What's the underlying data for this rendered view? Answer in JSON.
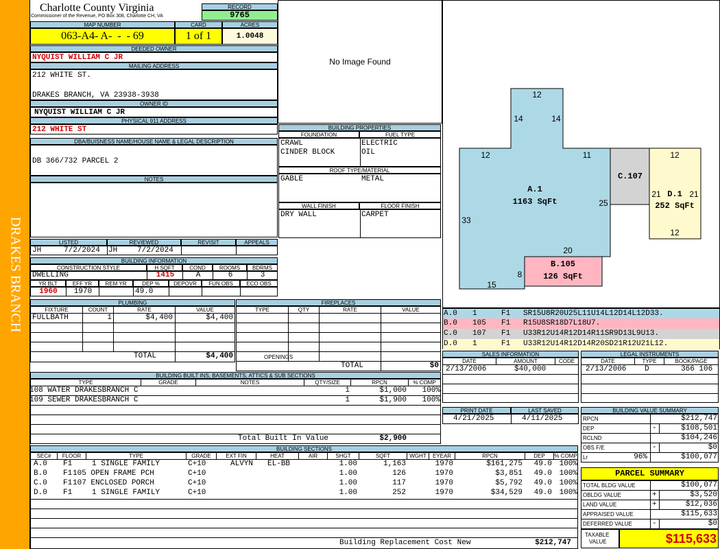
{
  "colors": {
    "sidebar": "#ffa500",
    "header_blue": "#a8cfe0",
    "map_yellow": "#ffff00",
    "record_green": "#90ee90",
    "accent_red": "#d00000",
    "seg_a": "#add8e6",
    "seg_b": "#ffb6c1",
    "seg_c": "#d3d3d3",
    "seg_d": "#fffacd"
  },
  "sidebar": {
    "district": "DRAKES BRANCH"
  },
  "header": {
    "county": "Charlotte County Virginia",
    "address": "Commissioner of the Revenue, PO Box 308, Charlotte CH, VA",
    "record_label": "RECORD",
    "record_value": "9765",
    "map_label": "MAP NUMBER",
    "map_value": "063-A4- A-  -  - 69",
    "card_label": "CARD",
    "card_value": "1 of 1",
    "acres_label": "ACRES",
    "acres_value": "1.0048"
  },
  "owner": {
    "deeded_label": "DEEDED OWNER",
    "deeded_value": "NYQUIST WILLIAM C JR",
    "mailing_label": "MAILING ADDRESS",
    "mailing_line1": "212 WHITE ST.",
    "mailing_line2": "DRAKES BRANCH, VA 23938-3938",
    "owner_id_label": "OWNER ID",
    "owner_id_value": "NYQUIST WILLIAM C JR",
    "physical_label": "PHYSICAL 911 ADDRESS",
    "physical_value": "212 WHITE ST",
    "dba_label": "DBA/BUISNESS NAME/HOUSE NAME & LEGAL DESCRIPTION",
    "dba_value": "DB 366/732 PARCEL 2",
    "notes_label": "NOTES"
  },
  "photo": {
    "text": "No Image Found"
  },
  "building_props": {
    "title": "BUILDING PROPERTIES",
    "foundation_label": "FOUNDATION",
    "foundation_values": [
      "CRAWL",
      "CINDER BLOCK"
    ],
    "fuel_label": "FUEL TYPE",
    "fuel_values": [
      "ELECTRIC",
      "OIL"
    ],
    "roof_label": "ROOF TYPE/MATERIAL",
    "roof_type": "GABLE",
    "roof_material": "METAL",
    "wall_label": "WALL FINISH",
    "wall_value": "DRY WALL",
    "floor_label": "FLOOR FINISH",
    "floor_value": "CARPET"
  },
  "review": {
    "listed_label": "LISTED",
    "reviewed_label": "REVIEWED",
    "revisit_label": "REVISIT",
    "appeals_label": "APPEALS",
    "listed_by": "JH",
    "listed_date": "7/2/2024",
    "reviewed_by": "JH",
    "reviewed_date": "7/2/2024"
  },
  "building_info": {
    "title": "BUILDING INFORMATION",
    "style_label": "CONSTRUCTION STYLE",
    "hsqft_label": "H SQFT",
    "cond_label": "COND",
    "rooms_label": "ROOMS",
    "bdrms_label": "BDRMS",
    "style": "DWELLING",
    "hsqft": "1415",
    "cond": "A",
    "rooms": "6",
    "bdrms": "3",
    "yrblt_label": "YR BLT",
    "effyr_label": "EFF YR",
    "remyr_label": "REM YR",
    "dep_label": "DEP %",
    "depovr_label": "DEPOVR",
    "funobs_label": "FUN OBS",
    "ecoobs_label": "ECO OBS",
    "yrblt": "1960",
    "effyr": "1970",
    "remyr": "",
    "dep": "49.0"
  },
  "plumbing": {
    "title": "PLUMBING",
    "headers": [
      "FIXTURE",
      "COUNT",
      "RATE",
      "VALUE"
    ],
    "rows": [
      {
        "fixture": "FULLBATH",
        "count": "1",
        "rate": "$4,400",
        "value": "$4,400"
      }
    ],
    "total_label": "TOTAL",
    "total_value": "$4,400"
  },
  "fireplaces": {
    "title": "FIREPLACES",
    "headers": [
      "TYPE",
      "QTY",
      "RATE",
      "VALUE"
    ],
    "openings_label": "OPENINGS",
    "total_label": "TOTAL",
    "total_value": "$0"
  },
  "builtins": {
    "title": "BUILDING BUILT INS, BASEMENTS, ATTICS & SUB SECTIONS",
    "headers": [
      "TYPE",
      "GRADE",
      "NOTES",
      "QTY/SIZE",
      "RPCN",
      "% COMP"
    ],
    "rows": [
      {
        "type": "108 WATER DRAKESBRANCH C",
        "qty": "1",
        "rpcn": "$1,000",
        "comp": "100%"
      },
      {
        "type": "109 SEWER DRAKESBRANCH C",
        "qty": "1",
        "rpcn": "$1,900",
        "comp": "100%"
      }
    ],
    "total_label": "Total Built In Value",
    "total_value": "$2,900"
  },
  "sketch": {
    "labels": {
      "a_name": "A.1",
      "a_area": "1163 SqFt",
      "b_name": "B.105",
      "b_area": "126 SqFt",
      "c_name": "C.107",
      "d_name": "D.1",
      "d_area": "252 SqFt"
    },
    "dims": [
      "12",
      "14",
      "14",
      "12",
      "11",
      "33",
      "25",
      "20",
      "8",
      "15",
      "12",
      "21",
      "21",
      "12"
    ]
  },
  "segments": [
    {
      "id": "A.0",
      "num": "1",
      "floor": "F1",
      "code": "SR15U8R20U25L11U14L12D14L12D33."
    },
    {
      "id": "B.0",
      "num": "105",
      "floor": "F1",
      "code": "R15U8SR18D7L18U7."
    },
    {
      "id": "C.0",
      "num": "107",
      "floor": "F1",
      "code": "U33R12U14R12D14R11SR9D13L9U13."
    },
    {
      "id": "D.0",
      "num": "1",
      "floor": "F1",
      "code": "U33R12U14R12D14R20SD21R12U21L12."
    }
  ],
  "sales": {
    "title": "SALES INFORMATION",
    "headers": [
      "DATE",
      "AMOUNT",
      "CODE"
    ],
    "rows": [
      {
        "date": "2/13/2006",
        "amount": "$40,000",
        "code": ""
      }
    ]
  },
  "legal": {
    "title": "LEGAL INSTRUMENTS",
    "headers": [
      "DATE",
      "TYPE",
      "BOOK/PAGE"
    ],
    "rows": [
      {
        "date": "2/13/2006",
        "type": "D",
        "book": "366 106"
      }
    ]
  },
  "dates": {
    "print_label": "PRINT DATE",
    "print_value": "4/21/2025",
    "saved_label": "LAST SAVED",
    "saved_value": "4/11/2025"
  },
  "value_summary": {
    "title": "BUILDING VALUE SUMMARY",
    "rows": [
      {
        "label": "RPCN",
        "sign": "",
        "value": "$212,747"
      },
      {
        "label": "DEP",
        "sign": "-",
        "value": "$108,501"
      },
      {
        "label": "RCLND",
        "sign": "",
        "value": "$104,246"
      },
      {
        "label": "OBS F/E",
        "sign": "-",
        "value": "$0"
      },
      {
        "label": "Lr",
        "pct": "96%",
        "sign": "",
        "value": "$100,077"
      }
    ]
  },
  "parcel_summary": {
    "title": "PARCEL SUMMARY",
    "rows": [
      {
        "label": "TOTAL BLDG VALUE",
        "sign": "",
        "value": "$100,077"
      },
      {
        "label": "OBLDG VALUE",
        "sign": "+",
        "value": "$3,520"
      },
      {
        "label": "LAND VALUE",
        "sign": "+",
        "value": "$12,036"
      },
      {
        "label": "APPRAISED VALUE",
        "sign": "",
        "value": "$115,633"
      },
      {
        "label": "DEFERRED VALUE",
        "sign": "-",
        "value": "$0"
      }
    ],
    "taxable_label1": "TAXABLE",
    "taxable_label2": "VALUE",
    "taxable_value": "$115,633"
  },
  "sections": {
    "title": "BUILDING SECTIONS",
    "headers": [
      "SEC#",
      "FLOOR",
      "TYPE",
      "GRADE",
      "EXT FIN",
      "HEAT",
      "AIR",
      "SHGT",
      "SQFT",
      "WGHT",
      "EYEAR",
      "RPCN",
      "DEP",
      "% COMP"
    ],
    "rows": [
      {
        "sec": "A.0",
        "floor": "F1",
        "type": "1 SINGLE FAMILY",
        "grade": "C+10",
        "ext": "ALVYN",
        "heat": "EL-BB",
        "air": "",
        "shgt": "1.00",
        "sqft": "1,163",
        "wght": "",
        "eyear": "1970",
        "rpcn": "$161,275",
        "dep": "49.0",
        "comp": "100%"
      },
      {
        "sec": "B.0",
        "floor": "F1",
        "type": "105 OPEN FRAME PCH",
        "grade": "C+10",
        "ext": "",
        "heat": "",
        "air": "",
        "shgt": "1.00",
        "sqft": "126",
        "wght": "",
        "eyear": "1970",
        "rpcn": "$3,851",
        "dep": "49.0",
        "comp": "100%"
      },
      {
        "sec": "C.0",
        "floor": "F1",
        "type": "107 ENCLOSED PORCH",
        "grade": "C+10",
        "ext": "",
        "heat": "",
        "air": "",
        "shgt": "1.00",
        "sqft": "117",
        "wght": "",
        "eyear": "1970",
        "rpcn": "$5,792",
        "dep": "49.0",
        "comp": "100%"
      },
      {
        "sec": "D.0",
        "floor": "F1",
        "type": "1 SINGLE FAMILY",
        "grade": "C+10",
        "ext": "",
        "heat": "",
        "air": "",
        "shgt": "1.00",
        "sqft": "252",
        "wght": "",
        "eyear": "1970",
        "rpcn": "$34,529",
        "dep": "49.0",
        "comp": "100%"
      }
    ],
    "total_label": "Building Replacement Cost New",
    "total_value": "$212,747"
  }
}
